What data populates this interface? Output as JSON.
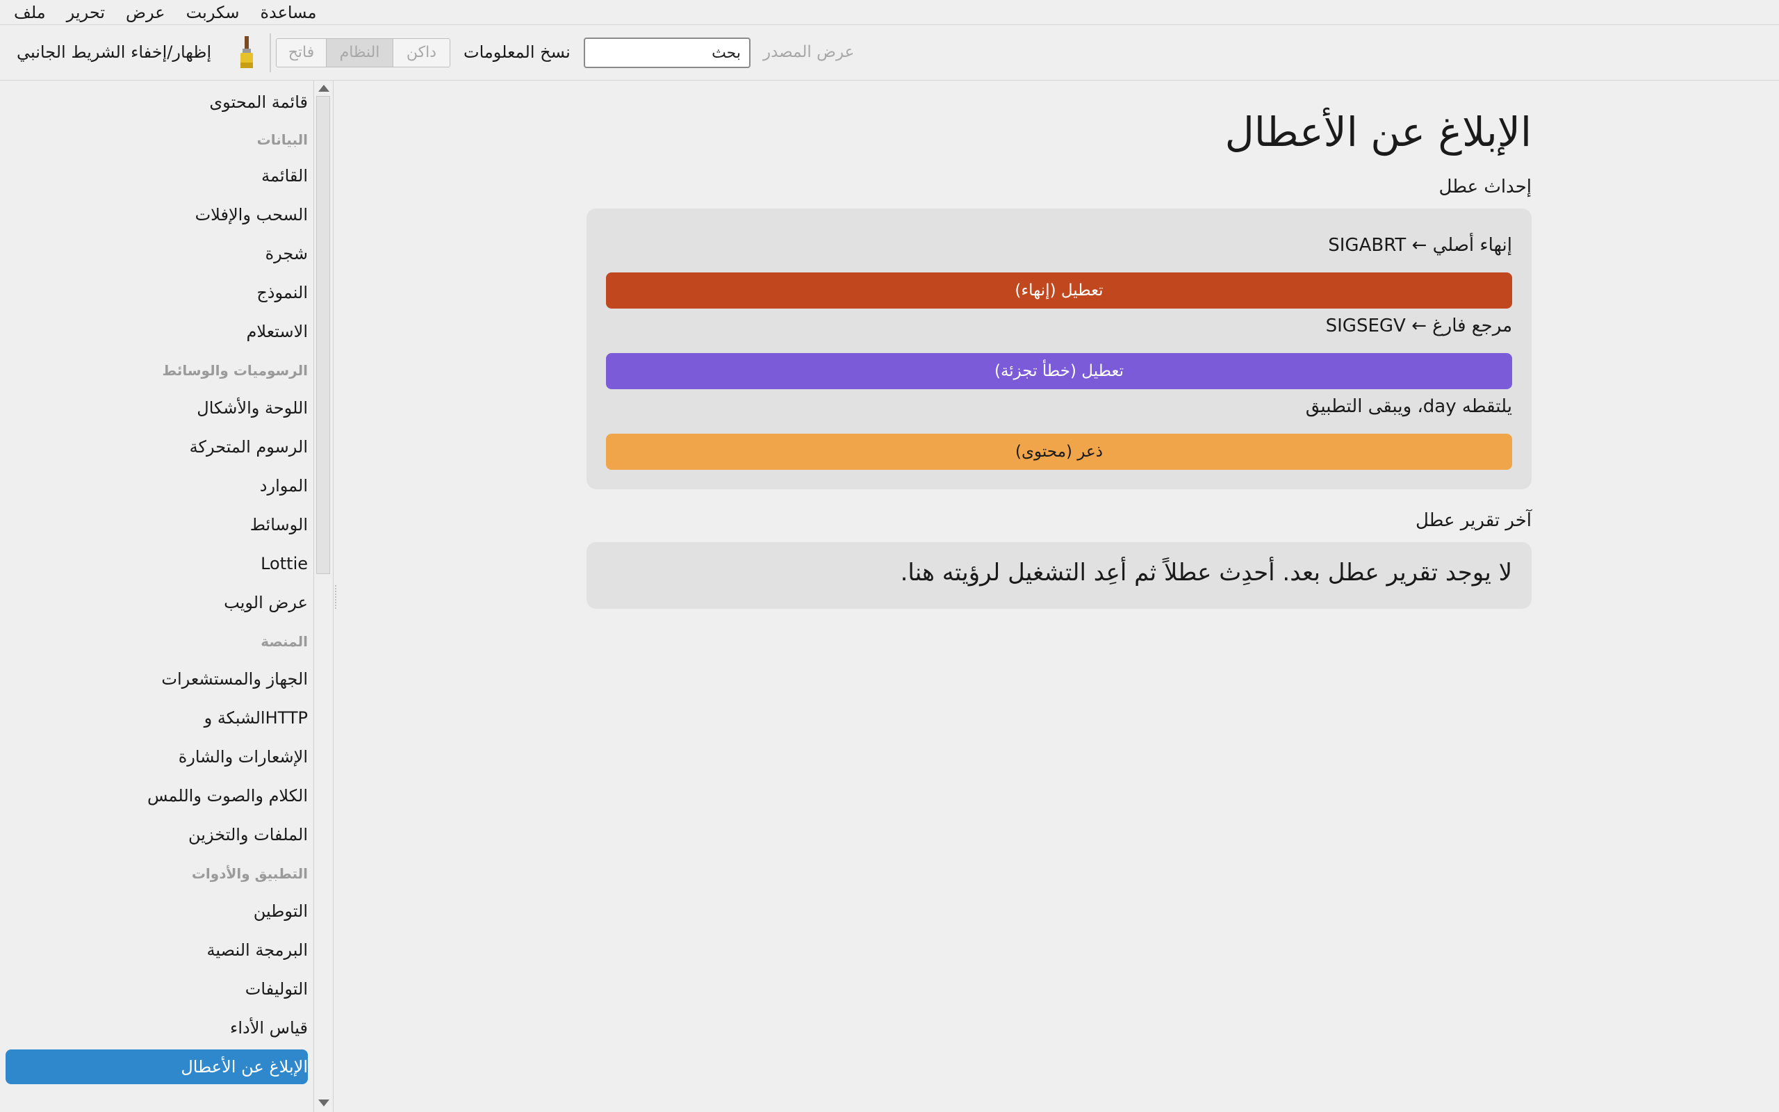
{
  "menu": {
    "items": [
      "مساعدة",
      "سكربت",
      "عرض",
      "تحرير",
      "ملف"
    ]
  },
  "toolbar": {
    "sidebar_toggle": "إظهار/إخفاء الشريط الجانبي",
    "theme_buttons": [
      "فاتح",
      "النظام",
      "داكن"
    ],
    "theme_selected": "النظام",
    "copy_info": "نسخ المعلومات",
    "search_value": "بحث",
    "view_source": "عرض المصدر"
  },
  "sidebar": {
    "items": [
      {
        "label": "قائمة المحتوى",
        "kind": "item"
      },
      {
        "label": "البيانات",
        "kind": "header"
      },
      {
        "label": "القائمة",
        "kind": "item"
      },
      {
        "label": "السحب والإفلات",
        "kind": "item"
      },
      {
        "label": "شجرة",
        "kind": "item"
      },
      {
        "label": "النموذج",
        "kind": "item"
      },
      {
        "label": "الاستعلام",
        "kind": "item"
      },
      {
        "label": "الرسوميات والوسائط",
        "kind": "header"
      },
      {
        "label": "اللوحة والأشكال",
        "kind": "item"
      },
      {
        "label": "الرسوم المتحركة",
        "kind": "item"
      },
      {
        "label": "الموارد",
        "kind": "item"
      },
      {
        "label": "الوسائط",
        "kind": "item"
      },
      {
        "label": "Lottie",
        "kind": "item"
      },
      {
        "label": "عرض الويب",
        "kind": "item"
      },
      {
        "label": "المنصة",
        "kind": "header"
      },
      {
        "label": "الجهاز والمستشعرات",
        "kind": "item"
      },
      {
        "label": "HTTPالشبكة و",
        "kind": "item"
      },
      {
        "label": "الإشعارات والشارة",
        "kind": "item"
      },
      {
        "label": "الكلام والصوت واللمس",
        "kind": "item"
      },
      {
        "label": "الملفات والتخزين",
        "kind": "item"
      },
      {
        "label": "التطبيق والأدوات",
        "kind": "header"
      },
      {
        "label": "التوطين",
        "kind": "item"
      },
      {
        "label": "البرمجة النصية",
        "kind": "item"
      },
      {
        "label": "التوليفات",
        "kind": "item"
      },
      {
        "label": "قياس الأداء",
        "kind": "item"
      },
      {
        "label": "الإبلاغ عن الأعطال",
        "kind": "item",
        "selected": true
      }
    ],
    "selected_color": "#2f88cc"
  },
  "main": {
    "title": "الإبلاغ عن الأعطال",
    "trigger_section": "إحداث عطل",
    "crashes": [
      {
        "label": "إنهاء أصلي ← SIGABRT",
        "button": "تعطيل (إنهاء)",
        "color": "#c1471e",
        "text_color": "#ffffff"
      },
      {
        "label": "مرجع فارغ ← SIGSEGV",
        "button": "تعطيل (خطأ تجزئة)",
        "color": "#7c5bd8",
        "text_color": "#ffffff"
      },
      {
        "label": "يلتقطه day، ويبقى التطبيق",
        "button": "ذعر (محتوى)",
        "color": "#f0a54b",
        "text_color": "#1a1a1a"
      }
    ],
    "report_section": "آخر تقرير عطل",
    "report_text": "لا يوجد تقرير عطل بعد. أحدِث عطلاً ثم أعِد التشغيل لرؤيته هنا."
  }
}
